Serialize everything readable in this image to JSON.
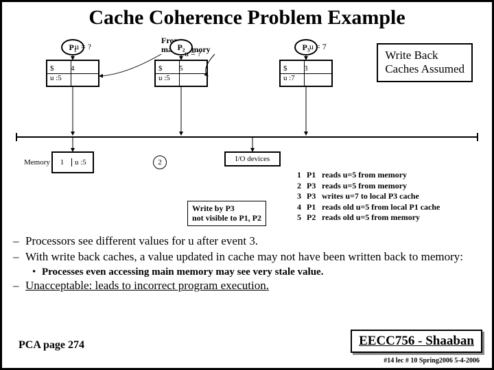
{
  "title": "Cache Coherence Problem Example",
  "caption_from": "From\nmain memory",
  "writeback_box": "Write Back\nCaches Assumed",
  "processors": {
    "p1": {
      "label": "P₁",
      "u": "u = ?",
      "s": "$",
      "ev": "4",
      "cache": "u :5"
    },
    "p2": {
      "label": "P₂",
      "u": "u = ?",
      "s": "$",
      "ev": "5",
      "cache": "u :5"
    },
    "p3": {
      "label": "P₃",
      "u": "u = 7",
      "s": "$",
      "ev": "3",
      "cache": "u :7"
    }
  },
  "memory": {
    "box1": "1",
    "label1": "Memory",
    "cell": "u :5",
    "box2": "2",
    "io": "I/O devices"
  },
  "events": [
    {
      "n": "1",
      "p": "P1",
      "t": "reads  u=5 from memory"
    },
    {
      "n": "2",
      "p": "P3",
      "t": "reads  u=5 from memory"
    },
    {
      "n": "3",
      "p": "P3",
      "t": "writes u=7 to local P3 cache"
    },
    {
      "n": "4",
      "p": "P1",
      "t": "reads old u=5 from local P1 cache"
    },
    {
      "n": "5",
      "p": "P2",
      "t": "reads old u=5 from memory"
    }
  ],
  "write_note": "Write by P3\nnot visible to P1, P2",
  "bullets": {
    "b1": "Processors see different values for  u   after event 3.",
    "b2": "With write back caches, a value updated in cache may not have been written back to memory:",
    "b2s": "Processes even accessing main memory may see very stale value.",
    "b3": "Unacceptable:  leads to incorrect program execution."
  },
  "footer": {
    "left": "PCA page 274",
    "box": "EECC756 - Shaaban",
    "sub": "#14  lec # 10   Spring2006  5-4-2006"
  }
}
